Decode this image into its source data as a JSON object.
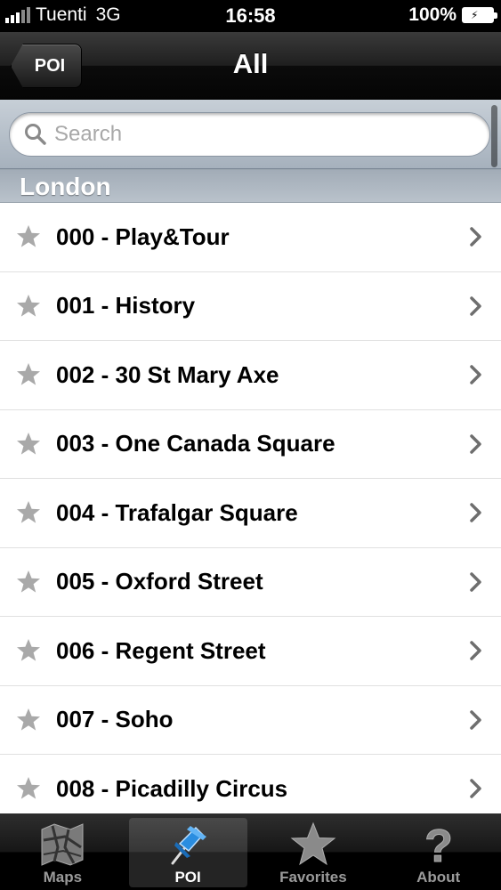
{
  "status_bar": {
    "carrier": "Tuenti",
    "network": "3G",
    "time": "16:58",
    "battery": "100%"
  },
  "nav": {
    "back_label": "POI",
    "title": "All"
  },
  "search": {
    "placeholder": "Search"
  },
  "section": {
    "title": "London"
  },
  "list_items": [
    "000 - Play&Tour",
    "001 - History",
    "002 - 30 St Mary Axe",
    "003 - One Canada Square",
    "004 - Trafalgar Square",
    "005 - Oxford Street",
    "006 - Regent Street",
    "007 - Soho",
    "008 - Picadilly Circus"
  ],
  "tabs": [
    {
      "label": "Maps",
      "icon": "map-icon"
    },
    {
      "label": "POI",
      "icon": "pushpin-icon",
      "active": true
    },
    {
      "label": "Favorites",
      "icon": "star-icon"
    },
    {
      "label": "About",
      "icon": "question-icon"
    }
  ],
  "colors": {
    "nav_bar": "#1f1f1f",
    "search_bar": "#b4bec9",
    "section_header": "#adb7c1",
    "tab_active_icon": "#2a8de0",
    "star_gray": "#a9a9a9"
  }
}
